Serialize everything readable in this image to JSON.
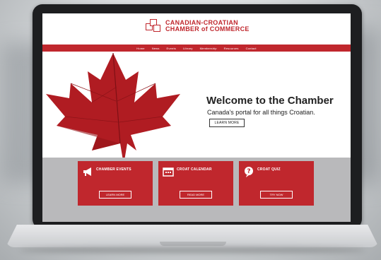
{
  "site": {
    "logo_line1": "CANADIAN-CROATIAN",
    "logo_line2": "CHAMBER of COMMERCE"
  },
  "nav": {
    "items": [
      "Home",
      "News",
      "Events",
      "Library",
      "Membership",
      "Resources",
      "Contact"
    ]
  },
  "hero": {
    "title": "Welcome to the Chamber",
    "subtitle": "Canada's portal for all things Croatian.",
    "button": "LEARN MORE"
  },
  "cards": [
    {
      "title": "CHAMBER EVENTS",
      "description": "",
      "button": "LEARN MORE",
      "icon": "megaphone-icon"
    },
    {
      "title": "CROAT CALENDAR",
      "description": "",
      "button": "READ MORE",
      "icon": "calendar-icon"
    },
    {
      "title": "CROAT QUIZ",
      "description": "",
      "button": "TRY NOW",
      "icon": "question-icon"
    }
  ],
  "colors": {
    "brand_red": "#c0272d",
    "card_strip": "#b9b9bb",
    "laptop_bezel": "#1d1e20"
  }
}
